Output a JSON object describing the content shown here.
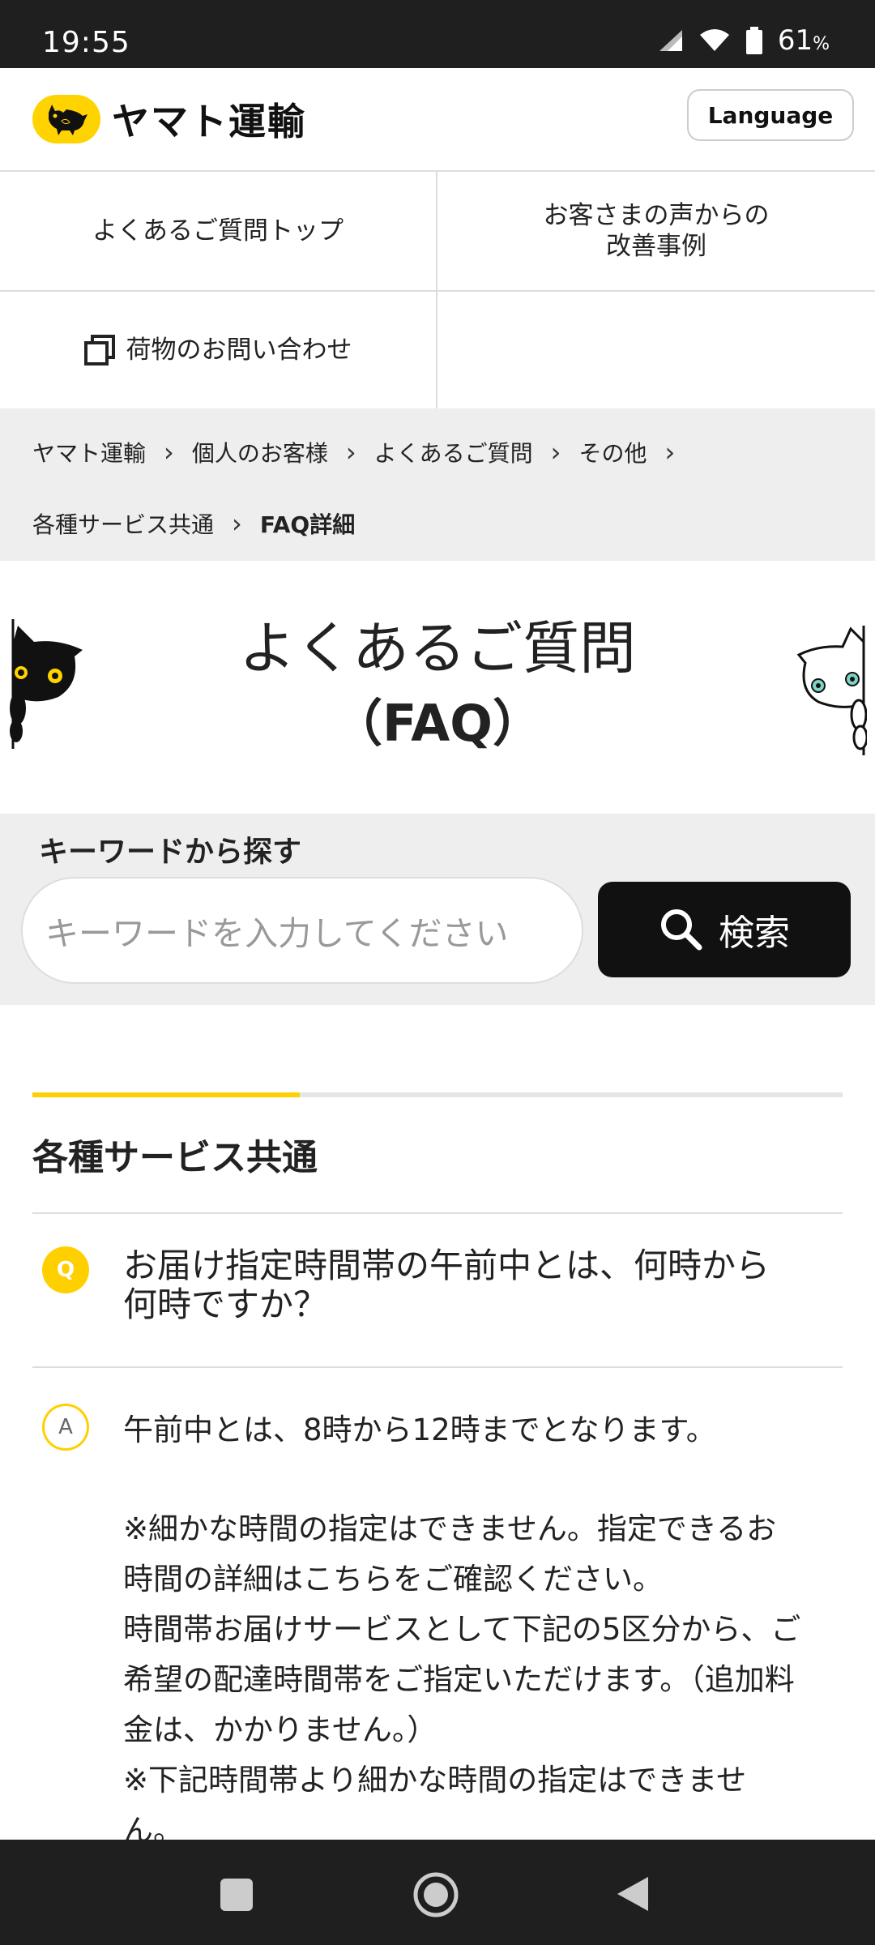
{
  "status_bar": {
    "time": "19:55",
    "battery_percent": "61",
    "battery_unit": "%"
  },
  "header": {
    "brand": "ヤマト運輸",
    "language_button": "Language"
  },
  "nav": {
    "faq_top": "よくあるご質問トップ",
    "voice_line1": "お客さまの声からの",
    "voice_line2": "改善事例",
    "tracking": "荷物のお問い合わせ"
  },
  "breadcrumb": {
    "items": [
      "ヤマト運輸",
      "個人のお客様",
      "よくあるご質問",
      "その他",
      "各種サービス共通",
      "FAQ詳細"
    ]
  },
  "title": {
    "line1": "よくあるご質問",
    "line2": "（FAQ）"
  },
  "search": {
    "label": "キーワードから探す",
    "placeholder": "キーワードを入力してください",
    "button": "検索"
  },
  "section": {
    "title": "各種サービス共通"
  },
  "qa": {
    "q_badge": "Q",
    "question_line1": "お届け指定時間帯の午前中とは、何時から",
    "question_line2": "何時ですか？",
    "a_badge": "A",
    "answer_line1": "午前中とは、8時から12時までとなります。",
    "answer_line2": "※細かな時間の指定はできません。指定できるお",
    "answer_line3": "時間の詳細はこちらをご確認ください。",
    "answer_line4": "時間帯お届けサービスとして下記の5区分から、ご",
    "answer_line5": "希望の配達時間帯をご指定いただけます。（追加料",
    "answer_line6": "金は、かかりません。）",
    "answer_line7": "※下記時間帯より細かな時間の指定はできませ",
    "answer_line8": "ん。"
  },
  "colors": {
    "accent_yellow": "#ffd000",
    "dark": "#111111",
    "grey_bg": "#eeeeee"
  }
}
